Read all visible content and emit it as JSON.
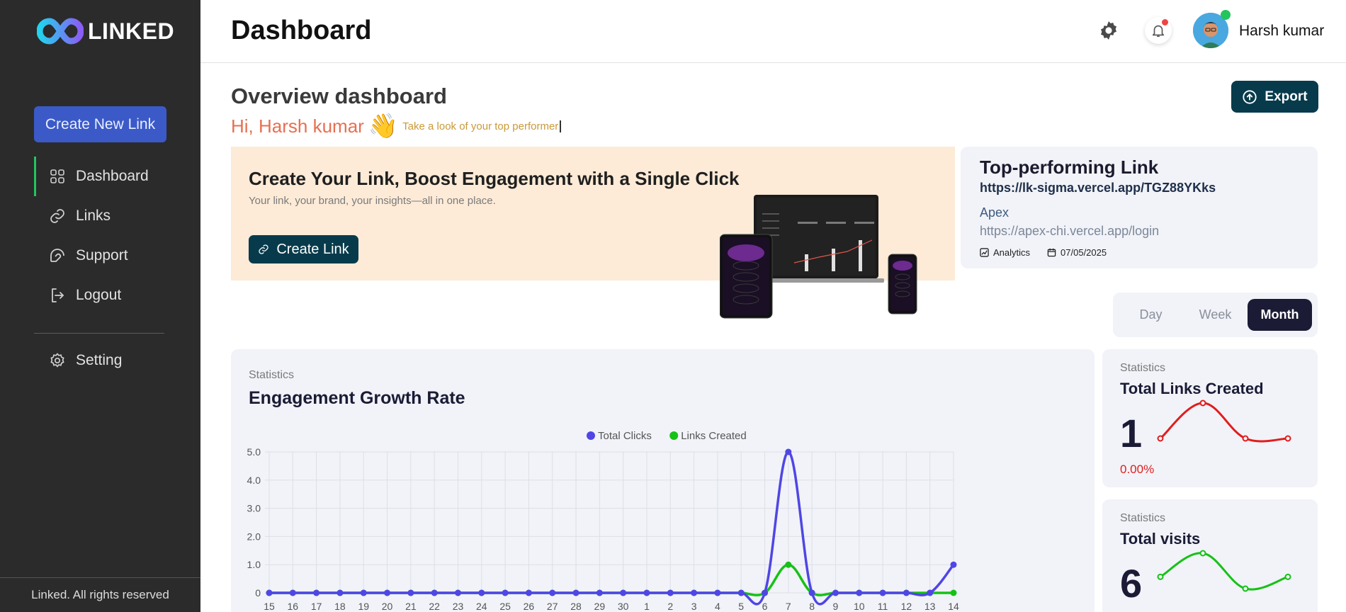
{
  "brand": {
    "name": "LINKED"
  },
  "sidebar": {
    "create_label": "Create New Link",
    "items": [
      {
        "label": "Dashboard",
        "icon": "grid-icon",
        "active": true
      },
      {
        "label": "Links",
        "icon": "link-icon"
      },
      {
        "label": "Support",
        "icon": "support-icon"
      },
      {
        "label": "Logout",
        "icon": "logout-icon"
      }
    ],
    "setting_label": "Setting",
    "footer": "Linked. All rights reserved"
  },
  "header": {
    "title": "Dashboard",
    "user_name": "Harsh kumar"
  },
  "overview": {
    "title": "Overview dashboard",
    "greeting": "Hi, Harsh kumar",
    "wave": "👋",
    "subtitle": "Take a look of your top performer",
    "export_label": "Export"
  },
  "banner": {
    "title": "Create Your Link, Boost Engagement with a Single Click",
    "subtitle": "Your link, your brand, your insights—all in one place.",
    "button_label": "Create Link"
  },
  "top_link": {
    "title": "Top-performing Link",
    "short_url": "https://lk-sigma.vercel.app/TGZ88YKks",
    "name": "Apex",
    "original_url": "https://apex-chi.vercel.app/login",
    "analytics_label": "Analytics",
    "date": "07/05/2025"
  },
  "range_tabs": [
    {
      "label": "Day",
      "active": false
    },
    {
      "label": "Week",
      "active": false
    },
    {
      "label": "Month",
      "active": true
    }
  ],
  "engagement": {
    "kicker": "Statistics",
    "title": "Engagement Growth Rate"
  },
  "chart_data": [
    {
      "type": "line",
      "title": "Engagement Growth Rate",
      "categories": [
        "15",
        "16",
        "17",
        "18",
        "19",
        "20",
        "21",
        "22",
        "23",
        "24",
        "25",
        "26",
        "27",
        "28",
        "29",
        "30",
        "1",
        "2",
        "3",
        "4",
        "5",
        "6",
        "7",
        "8",
        "9",
        "10",
        "11",
        "12",
        "13",
        "14"
      ],
      "series": [
        {
          "name": "Total Clicks",
          "color": "#4f46e5",
          "values": [
            0,
            0,
            0,
            0,
            0,
            0,
            0,
            0,
            0,
            0,
            0,
            0,
            0,
            0,
            0,
            0,
            0,
            0,
            0,
            0,
            0,
            0,
            5,
            0,
            0,
            0,
            0,
            0,
            0,
            1
          ]
        },
        {
          "name": "Links Created",
          "color": "#16c116",
          "values": [
            0,
            0,
            0,
            0,
            0,
            0,
            0,
            0,
            0,
            0,
            0,
            0,
            0,
            0,
            0,
            0,
            0,
            0,
            0,
            0,
            0,
            0,
            1,
            0,
            0,
            0,
            0,
            0,
            0,
            0
          ]
        }
      ],
      "yticks": [
        "0",
        "1.0",
        "2.0",
        "3.0",
        "4.0",
        "5.0"
      ],
      "ylim": [
        0,
        5
      ],
      "grid": true,
      "legend": "top-center"
    },
    {
      "type": "line",
      "title": "Total Links Created",
      "series": [
        {
          "color": "#e11d1d",
          "values": [
            1,
            2,
            1,
            1
          ]
        }
      ]
    },
    {
      "type": "line",
      "title": "Total visits",
      "series": [
        {
          "color": "#16c116",
          "values": [
            1,
            2,
            0.5,
            1
          ]
        }
      ]
    }
  ],
  "stats": [
    {
      "kicker": "Statistics",
      "title": "Total Links Created",
      "value": "1",
      "change": "0.00%"
    },
    {
      "kicker": "Statistics",
      "title": "Total visits",
      "value": "6"
    }
  ]
}
